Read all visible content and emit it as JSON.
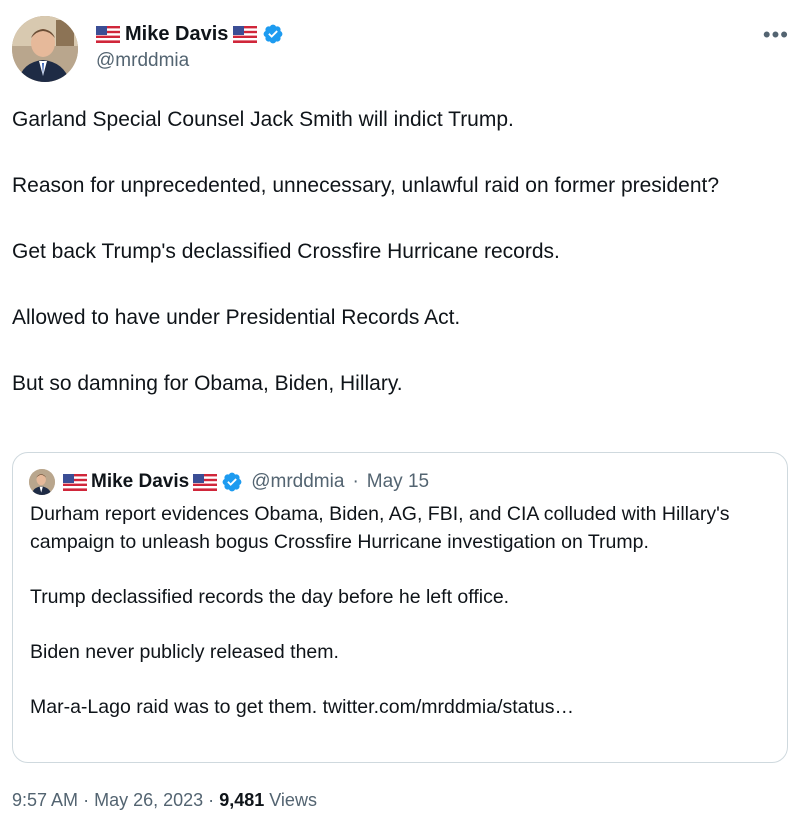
{
  "tweet": {
    "author": {
      "display_name": "Mike Davis",
      "handle": "@mrddmia",
      "verified": true,
      "avatar_icon": "profile-photo",
      "flag_icon": "us-flag-emoji"
    },
    "more_icon": "more-options-icon",
    "body": [
      "Garland Special Counsel Jack Smith will indict Trump.",
      "Reason for unprecedented, unnecessary, unlawful raid on former president?",
      "Get back Trump's declassified Crossfire Hurricane records.",
      "Allowed to have under Presidential Records Act.",
      "But so damning for Obama, Biden, Hillary."
    ],
    "quoted": {
      "display_name": "Mike Davis",
      "handle": "@mrddmia",
      "separator": "·",
      "date": "May 15",
      "body": [
        "Durham report evidences Obama, Biden, AG, FBI, and CIA colluded with Hillary's campaign to unleash bogus Crossfire Hurricane investigation on Trump.",
        "Trump declassified records the day before he left office.",
        "Biden never publicly released them.",
        "Mar-a-Lago raid was to get them. twitter.com/mrddmia/status…"
      ]
    },
    "footer": {
      "time": "9:57 AM",
      "separator": "·",
      "date": "May 26, 2023",
      "separator2": "·",
      "views_count": "9,481",
      "views_label": "Views"
    },
    "colors": {
      "text": "#0f1419",
      "secondary": "#536471",
      "verified_blue": "#1d9bf0",
      "border": "#cfd9de"
    }
  }
}
